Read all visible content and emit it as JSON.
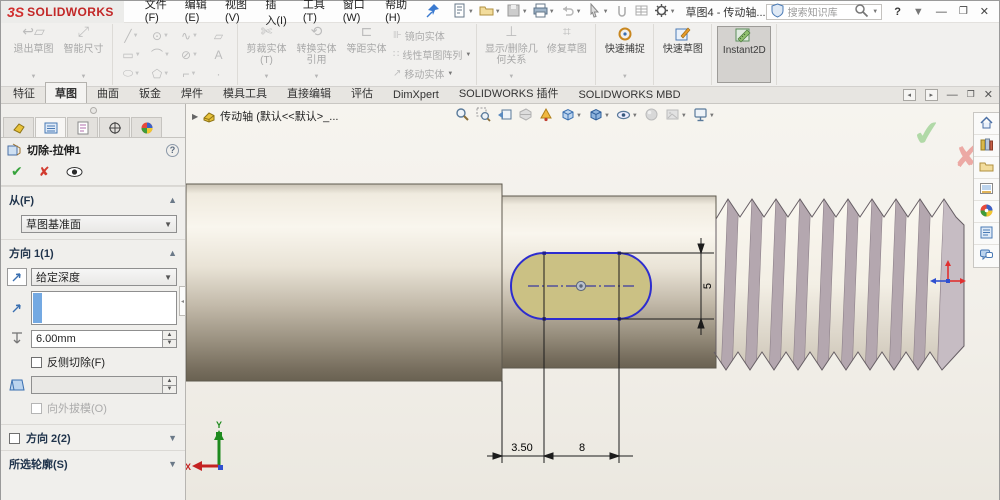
{
  "titlebar": {
    "brand_mark": "3S",
    "brand": "SOLIDWORKS",
    "menus": [
      "文件(F)",
      "编辑(E)",
      "视图(V)",
      "插入(I)",
      "工具(T)",
      "窗口(W)",
      "帮助(H)"
    ],
    "doc_title": "草图4 - 传动轴...",
    "search_placeholder": "搜索知识库",
    "help_label": "?",
    "quick_access_icons": [
      "new-icon",
      "open-icon",
      "save-icon",
      "print-icon",
      "undo-icon",
      "select-icon",
      "attach-icon",
      "cells-icon",
      "options-gear-icon"
    ]
  },
  "ribbon": {
    "exit_sketch": "退出草图",
    "smart_dimension": "智能尺寸",
    "trim": "剪裁实体(T)",
    "convert": "转换实体引用",
    "offset": "等距实体",
    "mirror": "镜向实体",
    "linear_pattern": "线性草图阵列",
    "move": "移动实体",
    "relations": "显示/删除几何关系",
    "repair": "修复草图",
    "quick_snaps": "快速捕捉",
    "rapid_sketch": "快速草图",
    "instant2d": "Instant2D"
  },
  "tabs": {
    "items": [
      "特征",
      "草图",
      "曲面",
      "钣金",
      "焊件",
      "模具工具",
      "直接编辑",
      "评估",
      "DimXpert",
      "SOLIDWORKS 插件",
      "SOLIDWORKS MBD"
    ],
    "active_index": 1
  },
  "panel": {
    "title": "切除-拉伸1",
    "from_label": "从(F)",
    "from_value": "草图基准面",
    "dir1_label": "方向 1(1)",
    "dir1_condition": "给定深度",
    "depth_value": "6.00mm",
    "flip_label": "反侧切除(F)",
    "draft_label": "向外拔模(O)",
    "dir2_label": "方向 2(2)",
    "contours_label": "所选轮廓(S)"
  },
  "graphics": {
    "tree_label": "传动轴 (默认<<默认>_...",
    "dim_width_small": "3.50",
    "dim_width_large": "8",
    "dim_height": "5",
    "triad_x": "X",
    "triad_y": "Y",
    "headsup_icons": [
      "zoom-fit-icon",
      "zoom-area-icon",
      "previous-view-icon",
      "section-view-icon",
      "annotation-view-icon",
      "view-orientation-icon",
      "display-style-icon",
      "hide-show-items-icon",
      "edit-appearance-icon",
      "apply-scene-icon",
      "view-settings-icon"
    ],
    "taskpane_icons": [
      "home-icon",
      "design-library-icon",
      "file-explorer-icon",
      "view-palette-icon",
      "appearances-icon",
      "custom-properties-icon",
      "forum-icon"
    ]
  },
  "colors": {
    "accent_blue": "#74a9e2",
    "slot_fill": "#cbc184",
    "slot_outline": "#2d2dcf",
    "thread_mauve": "#b4a7af",
    "confirm_green": "#78c36e",
    "confirm_red": "#e67873"
  }
}
